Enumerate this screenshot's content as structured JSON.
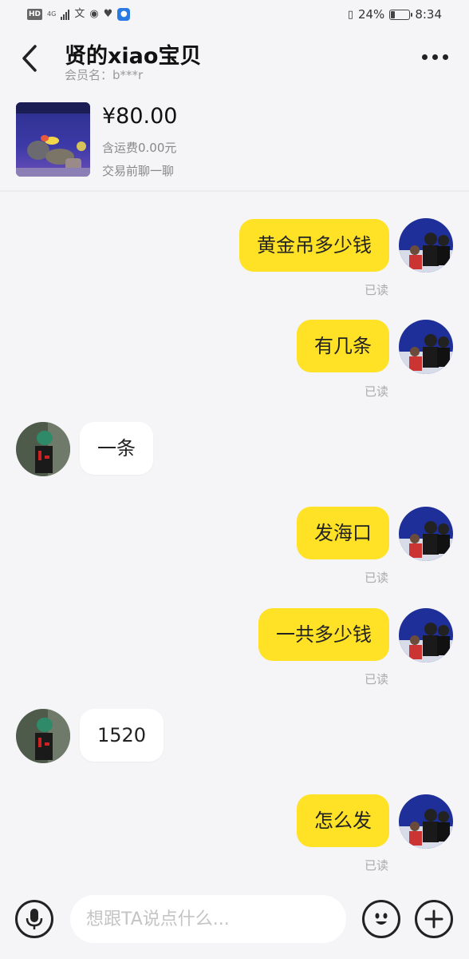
{
  "status_bar": {
    "hd": "HD",
    "network": "4G",
    "battery": "24%",
    "battery_level": 0.24,
    "time": "8:34"
  },
  "header": {
    "title": "贤的xiao宝贝",
    "member_name": "会员名：b***r"
  },
  "product": {
    "price": "¥80.00",
    "shipping": "含运费0.00元",
    "chat_first": "交易前聊一聊"
  },
  "messages": [
    {
      "side": "me",
      "text": "黄金吊多少钱",
      "status": "已读"
    },
    {
      "side": "me",
      "text": "有几条",
      "status": "已读"
    },
    {
      "side": "them",
      "text": "一条"
    },
    {
      "side": "me",
      "text": "发海口",
      "status": "已读"
    },
    {
      "side": "me",
      "text": "一共多少钱",
      "status": "已读"
    },
    {
      "side": "them",
      "text": "1520"
    },
    {
      "side": "me",
      "text": "怎么发",
      "status": "已读"
    }
  ],
  "input": {
    "placeholder": "想跟TA说点什么..."
  },
  "icons": {
    "back": "chevron-left-icon",
    "more": "more-dots-icon",
    "mic": "microphone-icon",
    "emoji": "emoji-icon",
    "plus": "plus-icon"
  },
  "colors": {
    "my_bubble": "#ffe226",
    "their_bubble": "#ffffff",
    "background": "#f5f5f7"
  }
}
